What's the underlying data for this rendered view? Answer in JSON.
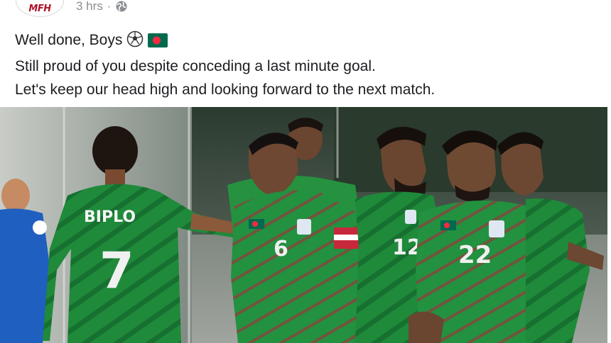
{
  "post": {
    "page_logo_text": "MFH",
    "timestamp": "3 hrs",
    "separator": "·",
    "privacy_icon": "globe-icon",
    "text_line_1": "Well done, Boys",
    "text_line_2": "Still proud of you despite conceding a last minute goal.",
    "text_line_3": "Let's keep our head high and looking forward to the next match.",
    "emoji_1": "soccer-ball-icon",
    "emoji_2": "bangladesh-flag-icon"
  },
  "photo": {
    "jersey_name": "BIPLO",
    "jersey_number_1": "7",
    "jersey_number_2": "6",
    "jersey_number_3": "12",
    "jersey_number_4": "22"
  },
  "colors": {
    "jersey_green": "#1f8a3a",
    "jersey_dark_green": "#13652a",
    "opponent_blue": "#1f5fc0",
    "timestamp_gray": "#8a8d91",
    "text_dark": "#1c1e21"
  }
}
